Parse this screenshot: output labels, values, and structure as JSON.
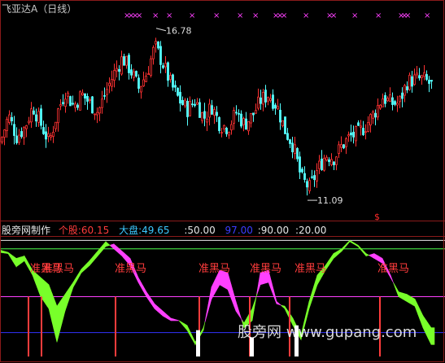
{
  "top_panel": {
    "title": "飞亚达A（日线）",
    "title_color": "#c8c8c8",
    "high_label": "16.78",
    "low_label": "11.09",
    "signal_label": "$",
    "marker_glyph": "×"
  },
  "bottom_panel": {
    "name": "股旁网制作",
    "stock": {
      "label": "个股:",
      "value": "60.15",
      "color": "#ff3c3c"
    },
    "market": {
      "label": "大盘:",
      "value": "49.65",
      "color": "#3cc8ff"
    },
    "levels": [
      {
        "text": ":50.00",
        "color": "#e6e6e6"
      },
      {
        "text": "97.00",
        "color": "#3c3cff"
      },
      {
        "text": ":90.00",
        "color": "#e6e6e6"
      },
      {
        "text": ":20.00",
        "color": "#e6e6e6"
      }
    ],
    "signal_text": "准黑马",
    "watermark": "股旁网  www.gupang.com"
  },
  "colors": {
    "up": "#ff3232",
    "down": "#54ffff",
    "magenta": "#ff40ff",
    "green": "#78ff2a",
    "red_line": "#ff3c3c",
    "blue_line": "#3232ff"
  },
  "chart_data": [
    {
      "type": "candlestick",
      "title": "飞亚达A（日线）",
      "ylim": [
        10.5,
        17.5
      ],
      "annotations": [
        {
          "text": "16.78",
          "value": 16.78,
          "kind": "high"
        },
        {
          "text": "11.09",
          "value": 11.09,
          "kind": "low"
        }
      ],
      "close_path": [
        [
          0,
          13.0
        ],
        [
          10,
          13.9
        ],
        [
          20,
          13.2
        ],
        [
          30,
          13.5
        ],
        [
          40,
          14.2
        ],
        [
          50,
          13.6
        ],
        [
          60,
          13.0
        ],
        [
          70,
          14.0
        ],
        [
          80,
          14.7
        ],
        [
          90,
          14.2
        ],
        [
          100,
          14.6
        ],
        [
          110,
          14.3
        ],
        [
          120,
          14.0
        ],
        [
          130,
          14.7
        ],
        [
          140,
          15.3
        ],
        [
          150,
          15.8
        ],
        [
          160,
          15.4
        ],
        [
          170,
          14.8
        ],
        [
          180,
          15.3
        ],
        [
          190,
          16.2
        ],
        [
          200,
          15.6
        ],
        [
          210,
          14.9
        ],
        [
          220,
          14.4
        ],
        [
          230,
          14.1
        ],
        [
          240,
          14.4
        ],
        [
          250,
          13.8
        ],
        [
          260,
          14.2
        ],
        [
          270,
          13.6
        ],
        [
          280,
          13.5
        ],
        [
          290,
          14.0
        ],
        [
          300,
          13.6
        ],
        [
          310,
          13.9
        ],
        [
          320,
          14.4
        ],
        [
          330,
          14.6
        ],
        [
          340,
          14.2
        ],
        [
          350,
          13.4
        ],
        [
          360,
          12.9
        ],
        [
          370,
          11.8
        ],
        [
          380,
          11.5
        ],
        [
          390,
          12.1
        ],
        [
          400,
          12.6
        ],
        [
          410,
          12.5
        ],
        [
          420,
          12.9
        ],
        [
          430,
          13.2
        ],
        [
          440,
          13.3
        ],
        [
          450,
          13.6
        ],
        [
          460,
          14.0
        ],
        [
          470,
          14.5
        ],
        [
          480,
          14.3
        ],
        [
          490,
          14.3
        ],
        [
          500,
          15.0
        ],
        [
          510,
          15.1
        ],
        [
          520,
          15.1
        ],
        [
          530,
          14.9
        ]
      ]
    },
    {
      "type": "area",
      "ylim": [
        0,
        100
      ],
      "reference_lines": [
        97,
        90,
        50,
        20
      ],
      "series": [
        {
          "name": "个股",
          "points": [
            [
              0,
              87
            ],
            [
              10,
              86
            ],
            [
              20,
              75
            ],
            [
              30,
              80
            ],
            [
              40,
              68
            ],
            [
              50,
              50
            ],
            [
              60,
              40
            ],
            [
              70,
              12
            ],
            [
              80,
              38
            ],
            [
              90,
              58
            ],
            [
              100,
              70
            ],
            [
              110,
              76
            ],
            [
              120,
              84
            ],
            [
              130,
              92
            ],
            [
              140,
              94
            ],
            [
              150,
              88
            ],
            [
              160,
              82
            ],
            [
              170,
              66
            ],
            [
              180,
              54
            ],
            [
              190,
              44
            ],
            [
              200,
              38
            ],
            [
              210,
              32
            ],
            [
              220,
              30
            ],
            [
              230,
              22
            ],
            [
              240,
              10
            ],
            [
              250,
              22
            ],
            [
              260,
              58
            ],
            [
              270,
              72
            ],
            [
              280,
              70
            ],
            [
              290,
              46
            ],
            [
              300,
              24
            ],
            [
              310,
              30
            ],
            [
              320,
              70
            ],
            [
              330,
              72
            ],
            [
              340,
              46
            ],
            [
              350,
              40
            ],
            [
              360,
              26
            ],
            [
              370,
              14
            ],
            [
              380,
              40
            ],
            [
              390,
              60
            ],
            [
              400,
              72
            ],
            [
              410,
              82
            ],
            [
              420,
              88
            ],
            [
              430,
              96
            ],
            [
              440,
              92
            ],
            [
              450,
              84
            ],
            [
              460,
              86
            ],
            [
              470,
              82
            ],
            [
              480,
              68
            ],
            [
              490,
              50
            ],
            [
              500,
              46
            ],
            [
              510,
              42
            ],
            [
              520,
              24
            ],
            [
              530,
              10
            ]
          ]
        },
        {
          "name": "大盘",
          "points": [
            [
              0,
              89
            ],
            [
              10,
              87
            ],
            [
              20,
              82
            ],
            [
              30,
              84
            ],
            [
              40,
              72
            ],
            [
              50,
              66
            ],
            [
              60,
              60
            ],
            [
              70,
              42
            ],
            [
              80,
              52
            ],
            [
              90,
              62
            ],
            [
              100,
              73
            ],
            [
              110,
              80
            ],
            [
              120,
              88
            ],
            [
              130,
              96
            ],
            [
              140,
              90
            ],
            [
              150,
              84
            ],
            [
              160,
              76
            ],
            [
              170,
              62
            ],
            [
              180,
              50
            ],
            [
              190,
              40
            ],
            [
              200,
              34
            ],
            [
              210,
              30
            ],
            [
              220,
              30
            ],
            [
              230,
              26
            ],
            [
              240,
              12
            ],
            [
              250,
              24
            ],
            [
              260,
              48
            ],
            [
              270,
              60
            ],
            [
              280,
              56
            ],
            [
              290,
              38
            ],
            [
              300,
              28
            ],
            [
              310,
              40
            ],
            [
              320,
              60
            ],
            [
              330,
              62
            ],
            [
              340,
              44
            ],
            [
              350,
              42
            ],
            [
              360,
              32
            ],
            [
              370,
              18
            ],
            [
              380,
              46
            ],
            [
              390,
              68
            ],
            [
              400,
              76
            ],
            [
              410,
              86
            ],
            [
              420,
              90
            ],
            [
              430,
              97
            ],
            [
              440,
              93
            ],
            [
              450,
              86
            ],
            [
              460,
              82
            ],
            [
              470,
              78
            ],
            [
              480,
              66
            ],
            [
              490,
              54
            ],
            [
              500,
              52
            ],
            [
              510,
              48
            ],
            [
              520,
              34
            ],
            [
              530,
              24
            ]
          ]
        }
      ]
    }
  ]
}
